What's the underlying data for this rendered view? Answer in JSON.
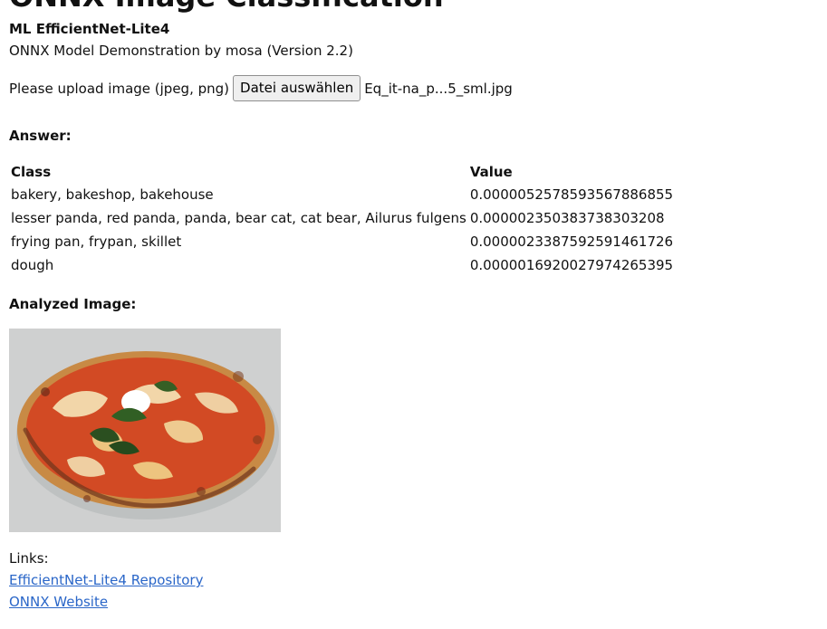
{
  "page": {
    "title": "ONNX Image Classification",
    "subtitle": "ML EfficientNet-Lite4",
    "description": "ONNX Model Demonstration by mosa (Version 2.2)"
  },
  "upload": {
    "label": "Please upload image (jpeg, png)",
    "button_label": "Datei auswählen",
    "file_name": "Eq_it-na_p...5_sml.jpg"
  },
  "answer": {
    "label": "Answer:",
    "headers": [
      "Class",
      "Value"
    ],
    "rows": [
      {
        "class": "bakery, bakeshop, bakehouse",
        "value": "0.0000052578593567886855"
      },
      {
        "class": "lesser panda, red panda, panda, bear cat, cat bear, Ailurus fulgens",
        "value": "0.000002350383738303208"
      },
      {
        "class": "frying pan, frypan, skillet",
        "value": "0.0000023387592591461726"
      },
      {
        "class": "dough",
        "value": "0.0000016920027974265395"
      }
    ]
  },
  "analyzed": {
    "label": "Analyzed Image:",
    "image_subject": "pizza"
  },
  "links": {
    "label": "Links:",
    "items": [
      {
        "text": "EfficientNet-Lite4 Repository"
      },
      {
        "text": "ONNX Website"
      }
    ]
  },
  "colors": {
    "link": "#2a66c8",
    "button_bg": "#efefef",
    "image_bg": "#cfd0d0",
    "crust": "#d39a4f",
    "sauce": "#d24a24",
    "cheese": "#f5e6b8",
    "basil": "#315f24"
  }
}
